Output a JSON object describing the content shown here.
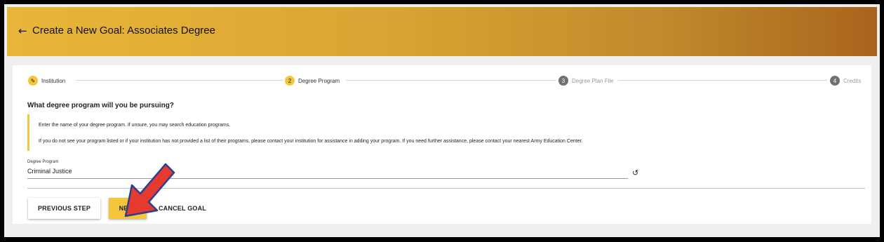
{
  "header": {
    "back_icon": "arrow-left-icon",
    "title": "Create a New Goal: Associates Degree"
  },
  "stepper": {
    "steps": [
      {
        "marker": "✎",
        "label": "Institution",
        "state": "completed"
      },
      {
        "marker": "2",
        "label": "Degree Program",
        "state": "active"
      },
      {
        "marker": "3",
        "label": "Degree Plan File",
        "state": "inactive"
      },
      {
        "marker": "4",
        "label": "Credits",
        "state": "inactive"
      }
    ]
  },
  "form": {
    "question": "What degree program will you be pursuing?",
    "info_lines": [
      "Enter the name of your degree program. If unsure, you may search education programs.",
      "If you do not see your program listed or if your institution has not provided a list of their programs, please contact your institution for assistance in adding your program. If you need further assistance, please contact your nearest Army Education Center."
    ],
    "field_label": "Degree Program",
    "field_value": "Criminal Justice",
    "reset_icon": "undo-icon"
  },
  "actions": {
    "previous_label": "PREVIOUS STEP",
    "next_label": "NEXT",
    "cancel_label": "CANCEL GOAL"
  },
  "colors": {
    "accent": "#f4c63b",
    "header_start": "#e8b63a",
    "header_end": "#a9641d",
    "annotation_arrow": "#e53a2f"
  }
}
